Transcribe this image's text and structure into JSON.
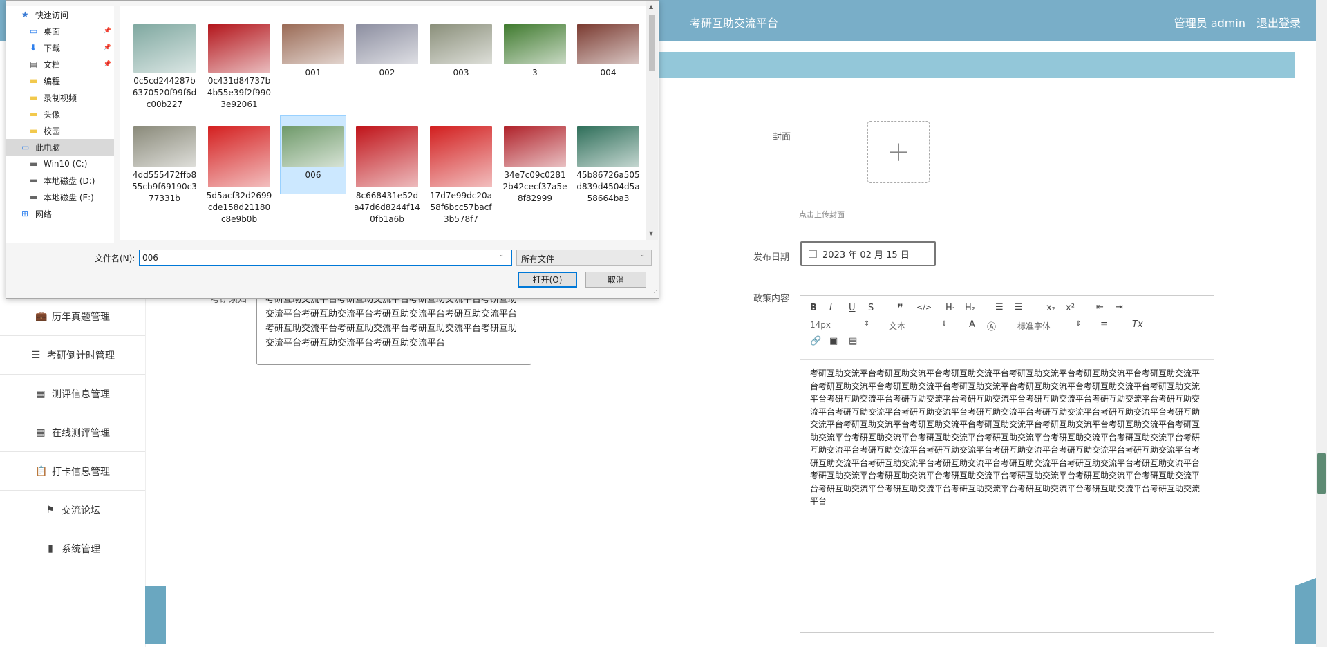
{
  "app": {
    "title": "考研互助交流平台",
    "user_label": "管理员 admin",
    "logout": "退出登录",
    "colors": {
      "header": "#79aec8",
      "subbar": "#93c7d9"
    }
  },
  "sidebar": {
    "items": [
      {
        "label": "历年真题管理",
        "icon": "briefcase-icon"
      },
      {
        "label": "考研倒计时管理",
        "icon": "list-icon"
      },
      {
        "label": "测评信息管理",
        "icon": "grid-icon"
      },
      {
        "label": "在线测评管理",
        "icon": "grid-icon"
      },
      {
        "label": "打卡信息管理",
        "icon": "clipboard-icon"
      },
      {
        "label": "交流论坛",
        "icon": "flag-icon"
      },
      {
        "label": "系统管理",
        "icon": "book-icon"
      }
    ]
  },
  "form": {
    "cover_label": "封面",
    "cover_hint": "点击上传封面",
    "date_label": "发布日期",
    "date_value": "2023 年 02 月 15 日",
    "content_label": "政策内容",
    "textarea_label": "考研须知",
    "textarea_text": "考研互助交流平台考研互助交流平台考研互助交流平台考研互助交流平台考研互助交流平台考研互助交流平台考研互助交流平台考研互助交流平台考研互助交流平台考研互助交流平台考研互助交流平台考研互助交流平台考研互助交流平台",
    "editor_font_size": "14px",
    "editor_block": "文本",
    "editor_font": "标准字体",
    "editor_text": "考研互助交流平台考研互助交流平台考研互助交流平台考研互助交流平台考研互助交流平台考研互助交流平台考研互助交流平台考研互助交流平台考研互助交流平台考研互助交流平台考研互助交流平台考研互助交流平台考研互助交流平台考研互助交流平台考研互助交流平台考研互助交流平台考研互助交流平台考研互助交流平台考研互助交流平台考研互助交流平台考研互助交流平台考研互助交流平台考研互助交流平台考研互助交流平台考研互助交流平台考研互助交流平台考研互助交流平台考研互助交流平台考研互助交流平台考研互助交流平台考研互助交流平台考研互助交流平台考研互助交流平台考研互助交流平台考研互助交流平台考研互助交流平台考研互助交流平台考研互助交流平台考研互助交流平台考研互助交流平台考研互助交流平台考研互助交流平台考研互助交流平台考研互助交流平台考研互助交流平台考研互助交流平台考研互助交流平台考研互助交流平台考研互助交流平台考研互助交流平台考研互助交流平台考研互助交流平台考研互助交流平台考研互助交流平台考研互助交流平台考研互助交流平台考研互助交流平台考研互助交流平台考研互助交流平台"
  },
  "dialog": {
    "nav": [
      {
        "label": "快速访问",
        "icon": "star-icon",
        "pinned": false,
        "selected": false,
        "indent": 1
      },
      {
        "label": "桌面",
        "icon": "desktop-icon",
        "pinned": true,
        "selected": false,
        "indent": 2
      },
      {
        "label": "下载",
        "icon": "download-icon",
        "pinned": true,
        "selected": false,
        "indent": 2
      },
      {
        "label": "文档",
        "icon": "document-icon",
        "pinned": true,
        "selected": false,
        "indent": 2
      },
      {
        "label": "编程",
        "icon": "folder-icon",
        "pinned": false,
        "selected": false,
        "indent": 2
      },
      {
        "label": "录制视频",
        "icon": "folder-icon",
        "pinned": false,
        "selected": false,
        "indent": 2
      },
      {
        "label": "头像",
        "icon": "folder-icon",
        "pinned": false,
        "selected": false,
        "indent": 2
      },
      {
        "label": "校园",
        "icon": "folder-icon",
        "pinned": false,
        "selected": false,
        "indent": 2
      },
      {
        "label": "此电脑",
        "icon": "computer-icon",
        "pinned": false,
        "selected": true,
        "indent": 1
      },
      {
        "label": "Win10 (C:)",
        "icon": "drive-icon",
        "pinned": false,
        "selected": false,
        "indent": 2
      },
      {
        "label": "本地磁盘 (D:)",
        "icon": "drive-icon",
        "pinned": false,
        "selected": false,
        "indent": 2
      },
      {
        "label": "本地磁盘 (E:)",
        "icon": "drive-icon",
        "pinned": false,
        "selected": false,
        "indent": 2
      },
      {
        "label": "网络",
        "icon": "network-icon",
        "pinned": false,
        "selected": false,
        "indent": 1
      }
    ],
    "files": [
      {
        "name": "0c5cd244287b6370520f99f6dc00b227",
        "color": "#7fa8a0",
        "selected": false
      },
      {
        "name": "0c431d84737b4b55e39f2f9903e92061",
        "color": "#b3151b",
        "selected": false
      },
      {
        "name": "001",
        "color": "#9a6a55",
        "selected": false
      },
      {
        "name": "002",
        "color": "#8c8ea0",
        "selected": false
      },
      {
        "name": "003",
        "color": "#8a8f7a",
        "selected": false
      },
      {
        "name": "3",
        "color": "#3f7a2e",
        "selected": false
      },
      {
        "name": "004",
        "color": "#7a3a30",
        "selected": false
      },
      {
        "name": "4dd555472ffb855cb9f69190c377331b",
        "color": "#8a8a7a",
        "selected": false
      },
      {
        "name": "5d5acf32d2699cde158d21180c8e9b0b",
        "color": "#d42020",
        "selected": false
      },
      {
        "name": "006",
        "color": "#6f9a6a",
        "selected": true
      },
      {
        "name": "8c668431e52da47d6d8244f140fb1a6b",
        "color": "#c0141a",
        "selected": false
      },
      {
        "name": "17d7e99dc20a58f6bcc57bacf3b578f7",
        "color": "#d21f1f",
        "selected": false
      },
      {
        "name": "34e7c09c02812b42cecf37a5e8f82999",
        "color": "#b0222a",
        "selected": false
      },
      {
        "name": "45b86726a505d839d4504d5a58664ba3",
        "color": "#2f6f5a",
        "selected": false
      }
    ],
    "filename_label": "文件名(N):",
    "filename_value": "006",
    "filetype_value": "所有文件",
    "open_button": "打开(O)",
    "cancel_button": "取消"
  }
}
